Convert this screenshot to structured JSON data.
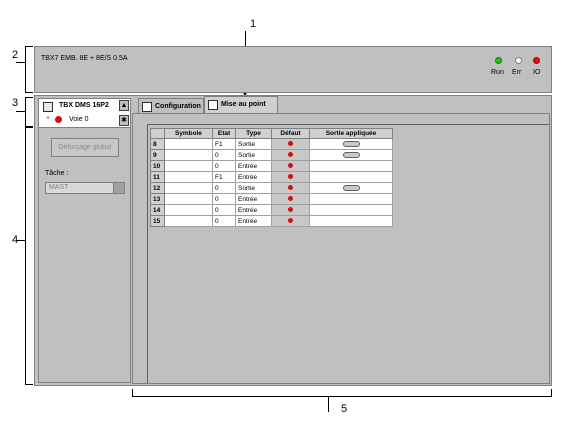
{
  "callouts": {
    "c1": "1",
    "c2": "2",
    "c3": "3",
    "c4": "4",
    "c5": "5"
  },
  "header": {
    "title": "TBX7 EMB. 8E + 8E/S 0.5A",
    "leds": [
      {
        "label": "Run",
        "color": "#20c020"
      },
      {
        "label": "Err",
        "color": "#ffffff"
      },
      {
        "label": "IO",
        "color": "#e01010"
      }
    ]
  },
  "module": {
    "name": "TBX DMS 16P2",
    "channel": "Voie 0",
    "channel_status_color": "#d01010",
    "expand_glyph": "+"
  },
  "tabs": [
    {
      "label": "Configuration",
      "active": false
    },
    {
      "label": "Mise au point",
      "active": true
    }
  ],
  "left_panel": {
    "global_unforce_label": "Déforçage global",
    "task_label": "Tâche :",
    "task_value": "MAST"
  },
  "table": {
    "columns": [
      "",
      "Symbole",
      "Etat",
      "Type",
      "Défaut",
      "Sortie appliquée"
    ],
    "rows": [
      {
        "num": "8",
        "symbol": "",
        "state": "F1",
        "type": "Sortie",
        "fault": true,
        "applied": true
      },
      {
        "num": "9",
        "symbol": "",
        "state": "0",
        "type": "Sortie",
        "fault": true,
        "applied": true
      },
      {
        "num": "10",
        "symbol": "",
        "state": "0",
        "type": "Entrée",
        "fault": true,
        "applied": false
      },
      {
        "num": "11",
        "symbol": "",
        "state": "F1",
        "type": "Entrée",
        "fault": true,
        "applied": false
      },
      {
        "num": "12",
        "symbol": "",
        "state": "0",
        "type": "Sortie",
        "fault": true,
        "applied": true
      },
      {
        "num": "13",
        "symbol": "",
        "state": "0",
        "type": "Entrée",
        "fault": true,
        "applied": false
      },
      {
        "num": "14",
        "symbol": "",
        "state": "0",
        "type": "Entrée",
        "fault": true,
        "applied": false
      },
      {
        "num": "15",
        "symbol": "",
        "state": "0",
        "type": "Entrée",
        "fault": true,
        "applied": false
      }
    ]
  }
}
